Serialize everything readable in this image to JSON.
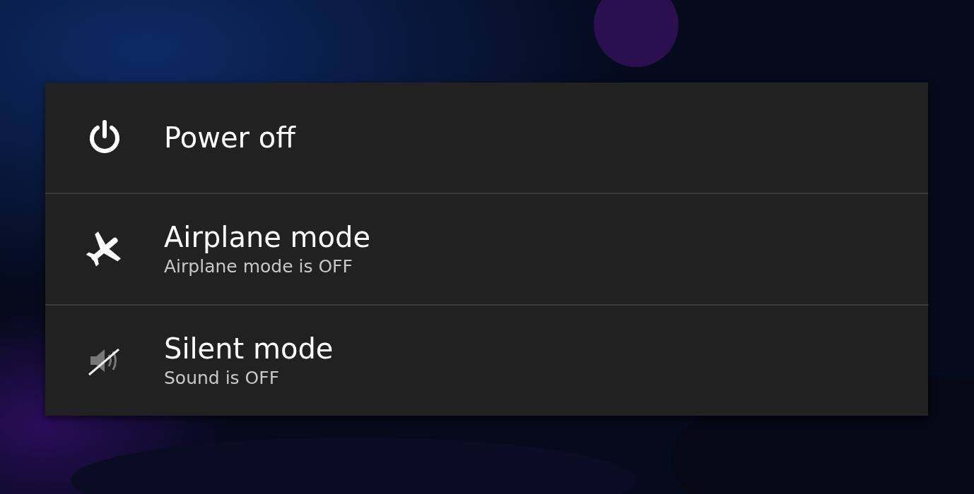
{
  "menu": {
    "items": [
      {
        "kind": "power",
        "label": "Power off"
      },
      {
        "kind": "airplane",
        "label": "Airplane mode",
        "subtitle": "Airplane mode is OFF"
      },
      {
        "kind": "silent",
        "label": "Silent mode",
        "subtitle": "Sound is OFF"
      }
    ]
  }
}
